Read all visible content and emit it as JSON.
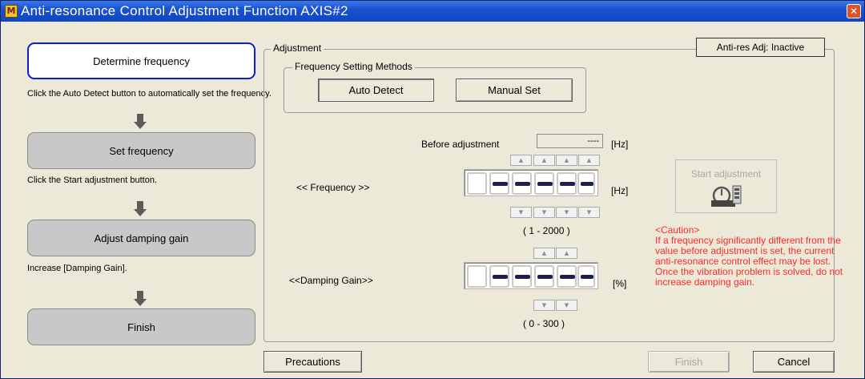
{
  "window": {
    "title": "Anti-resonance Control Adjustment Function AXIS#2",
    "app_icon_glyph": "M",
    "close_glyph": "✕"
  },
  "wizard": {
    "steps": [
      {
        "label": "Determine frequency",
        "state": "active"
      },
      {
        "label": "Set frequency",
        "state": "inactive"
      },
      {
        "label": "Adjust damping gain",
        "state": "inactive"
      },
      {
        "label": "Finish",
        "state": "inactive"
      }
    ],
    "hints": [
      "Click the Auto Detect button to automatically set the frequency.",
      "Click the Start adjustment button.",
      "Increase [Damping Gain]."
    ]
  },
  "adjustment": {
    "group_label": "Adjustment",
    "status": "Anti-res Adj: Inactive",
    "methods": {
      "group_label": "Frequency Setting Methods",
      "auto_detect": "Auto Detect",
      "manual_set": "Manual Set"
    },
    "before_label": "Before adjustment",
    "before_value": "----",
    "hz_unit": "[Hz]",
    "frequency_label": "<< Frequency >>",
    "frequency_range": "( 1 - 2000 )",
    "damping_label": "<<Damping Gain>>",
    "percent_unit": "[%]",
    "damping_range": "( 0 - 300 )",
    "start_adjustment": "Start adjustment",
    "spin_up_glyph": "▲",
    "spin_down_glyph": "▼",
    "caution": {
      "title": "<Caution>",
      "body": "If a frequency significantly different from the value before adjustment is set, the current anti-resonance control effect may be lost. Once the vibration problem is solved, do not increase damping gain."
    }
  },
  "footer": {
    "precautions": "Precautions",
    "finish": "Finish",
    "cancel": "Cancel"
  },
  "colors": {
    "title_bar": "#1a52d0",
    "active_step_border": "#0a1fd8",
    "caution_text": "#ff2a2a"
  }
}
